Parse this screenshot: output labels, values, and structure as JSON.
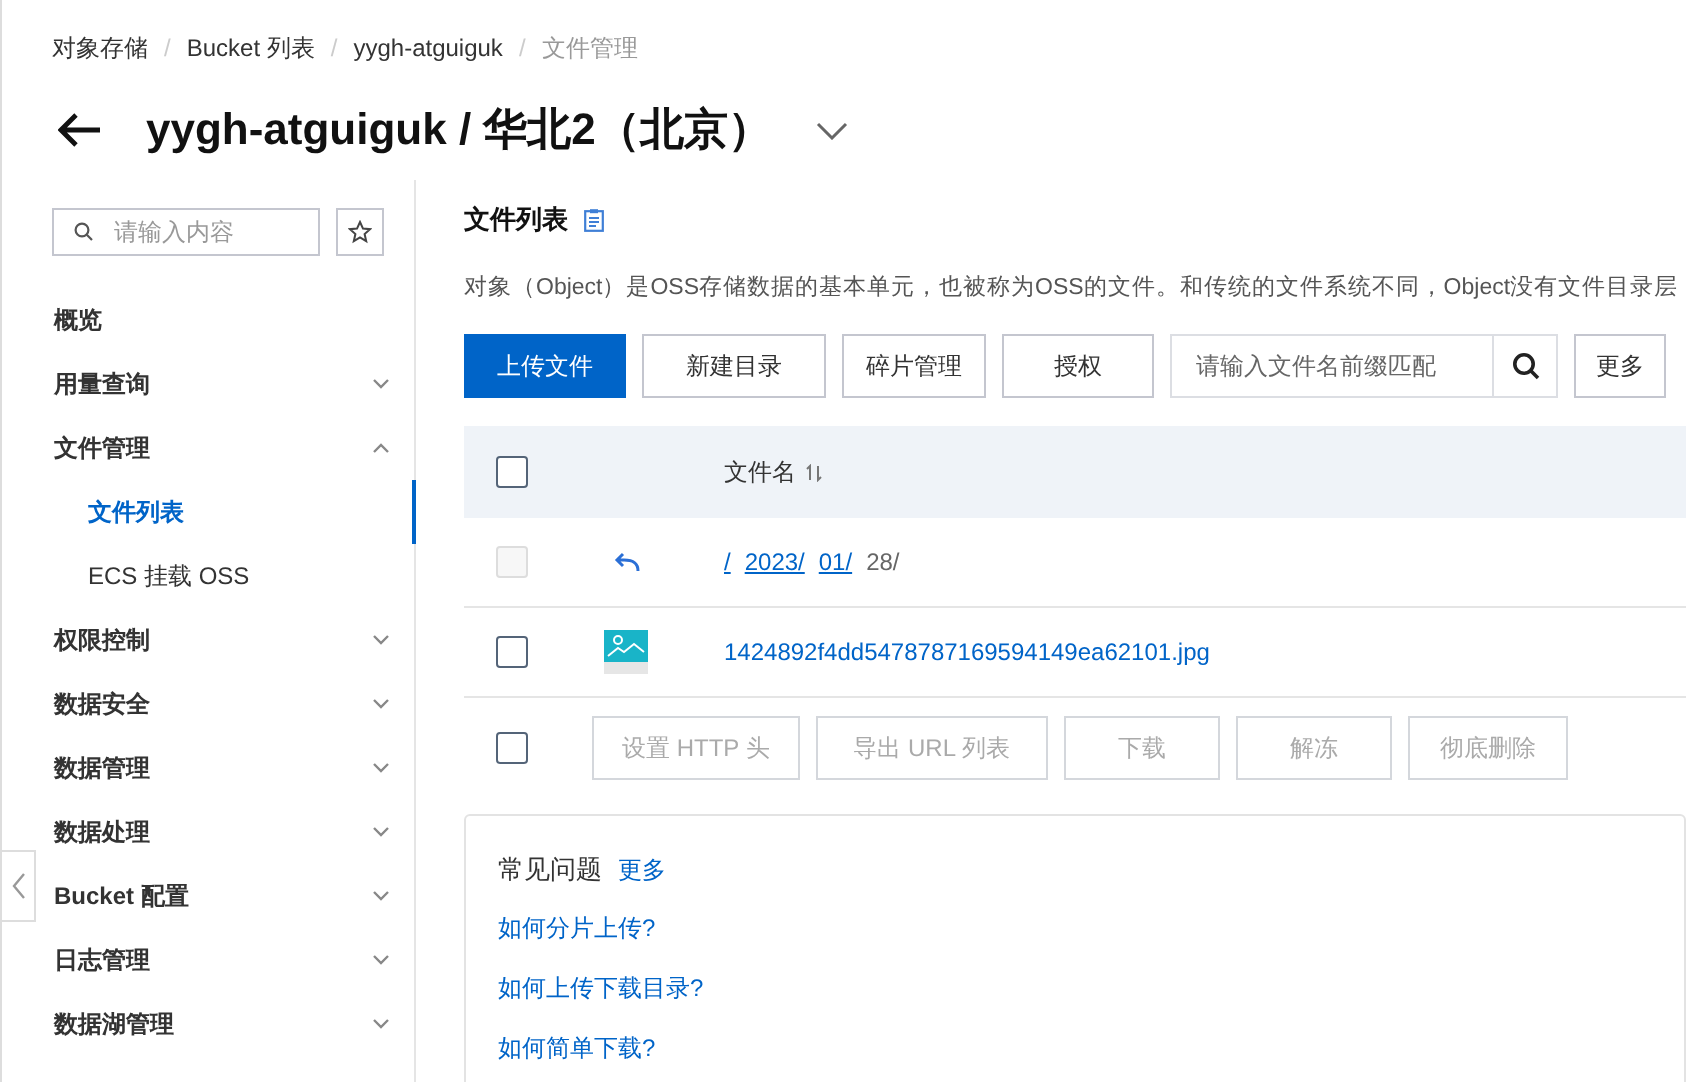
{
  "breadcrumb": [
    {
      "label": "对象存储",
      "current": false
    },
    {
      "separator": "/",
      "label": "Bucket 列表",
      "current": false
    },
    {
      "separator": "/",
      "label": "yygh-atguiguk",
      "current": false
    },
    {
      "separator": "/",
      "label": "文件管理",
      "current": true
    }
  ],
  "header": {
    "title": "yygh-atguiguk / 华北2（北京）"
  },
  "sidebar": {
    "search": {
      "placeholder": "请输入内容"
    },
    "items": [
      {
        "label": "概览",
        "expandable": false
      },
      {
        "label": "用量查询",
        "expandable": true,
        "expanded": false
      },
      {
        "label": "文件管理",
        "expandable": true,
        "expanded": true,
        "children": [
          {
            "label": "文件列表",
            "selected": true
          },
          {
            "label": "ECS 挂载 OSS",
            "selected": false
          }
        ]
      },
      {
        "label": "权限控制",
        "expandable": true,
        "expanded": false
      },
      {
        "label": "数据安全",
        "expandable": true,
        "expanded": false
      },
      {
        "label": "数据管理",
        "expandable": true,
        "expanded": false
      },
      {
        "label": "数据处理",
        "expandable": true,
        "expanded": false
      },
      {
        "label": "Bucket 配置",
        "expandable": true,
        "expanded": false
      },
      {
        "label": "日志管理",
        "expandable": true,
        "expanded": false
      },
      {
        "label": "数据湖管理",
        "expandable": true,
        "expanded": false
      }
    ]
  },
  "main": {
    "title": "文件列表",
    "description": "对象（Object）是OSS存储数据的基本单元，也被称为OSS的文件。和传统的文件系统不同，Object没有文件目录层",
    "toolbar": [
      {
        "label": "上传文件",
        "primary": true
      },
      {
        "label": "新建目录",
        "primary": false
      },
      {
        "label": "碎片管理",
        "primary": false
      },
      {
        "label": "授权",
        "primary": false
      }
    ],
    "search": {
      "placeholder": "请输入文件名前缀匹配"
    },
    "more_button": "更多",
    "table": {
      "header": {
        "label": "文件名",
        "checked": false
      },
      "rows": [
        {
          "kind": "path",
          "checked": false,
          "disabled": true,
          "segments": [
            {
              "label": "/",
              "link": true
            },
            {
              "label": "2023/",
              "link": true
            },
            {
              "label": "01/",
              "link": true
            },
            {
              "label": "28/",
              "link": false
            }
          ]
        },
        {
          "kind": "file",
          "checked": false,
          "disabled": false,
          "name": "1424892f4dd5478787169594149ea62101.jpg"
        }
      ],
      "footer": {
        "checked": false,
        "actions": [
          {
            "label": "设置 HTTP 头",
            "disabled": true
          },
          {
            "label": "导出 URL 列表",
            "disabled": true
          },
          {
            "label": "下载",
            "disabled": true
          },
          {
            "label": "解冻",
            "disabled": true
          },
          {
            "label": "彻底删除",
            "disabled": true
          }
        ]
      }
    },
    "faq": {
      "title": "常见问题",
      "more": "更多",
      "links": [
        "如何分片上传?",
        "如何上传下载目录?",
        "如何简单下载?"
      ]
    }
  }
}
